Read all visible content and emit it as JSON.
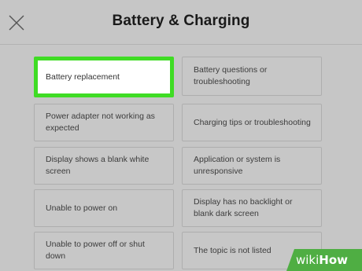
{
  "header": {
    "title": "Battery & Charging",
    "close_icon": "close-icon"
  },
  "options": [
    {
      "label": "Battery replacement",
      "selected": true
    },
    {
      "label": "Battery questions or troubleshooting",
      "selected": false
    },
    {
      "label": "Power adapter not working as expected",
      "selected": false
    },
    {
      "label": "Charging tips or troubleshooting",
      "selected": false
    },
    {
      "label": "Display shows a blank white screen",
      "selected": false
    },
    {
      "label": "Application or system is unresponsive",
      "selected": false
    },
    {
      "label": "Unable to power on",
      "selected": false
    },
    {
      "label": "Display has no backlight or blank dark screen",
      "selected": false
    },
    {
      "label": "Unable to power off or shut down",
      "selected": false
    },
    {
      "label": "The topic is not listed",
      "selected": false
    }
  ],
  "watermark": {
    "wiki": "wiki",
    "how": "How"
  },
  "colors": {
    "background": "#c6c6c6",
    "highlight": "#3fdc24",
    "watermark": "#4fae43"
  }
}
